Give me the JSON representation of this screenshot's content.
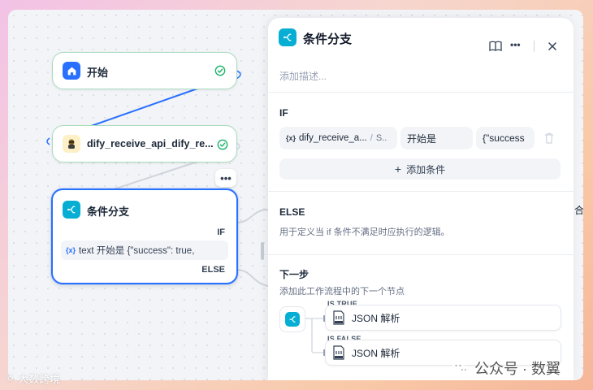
{
  "canvas": {
    "start_node": {
      "title": "开始"
    },
    "api_node": {
      "title": "dify_receive_api_dify_re..."
    },
    "ifelse_node": {
      "title": "条件分支",
      "if_label": "IF",
      "var_tag": "{x}",
      "condition_text": "text 开始是 {\"success\": true,",
      "else_label": "ELSE"
    },
    "more_button": "•••",
    "edge_label": "合"
  },
  "panel": {
    "title": "条件分支",
    "description_placeholder": "添加描述...",
    "if_section": {
      "heading": "IF",
      "variable": "dify_receive_a...",
      "variable_prefix": "{x}",
      "variable_suffix": "S..",
      "operator": "开始是",
      "value": "{\"success",
      "add_condition": "添加条件"
    },
    "else_section": {
      "heading": "ELSE",
      "description": "用于定义当 if 条件不满足时应执行的逻辑。"
    },
    "next_step": {
      "heading": "下一步",
      "description": "添加此工作流程中的下一个节点",
      "branches": [
        {
          "tag": "IS TRUE",
          "node_label": "JSON 解析"
        },
        {
          "tag": "IS FALSE",
          "node_label": "JSON 解析"
        }
      ]
    }
  },
  "watermarks": {
    "right": "公众号 · 数翼",
    "left": "大数跨境"
  },
  "colors": {
    "accent_teal": "#06aed4",
    "start_blue": "#2970ff",
    "success_green": "#17b26a",
    "edge_blue": "#2970ff"
  }
}
